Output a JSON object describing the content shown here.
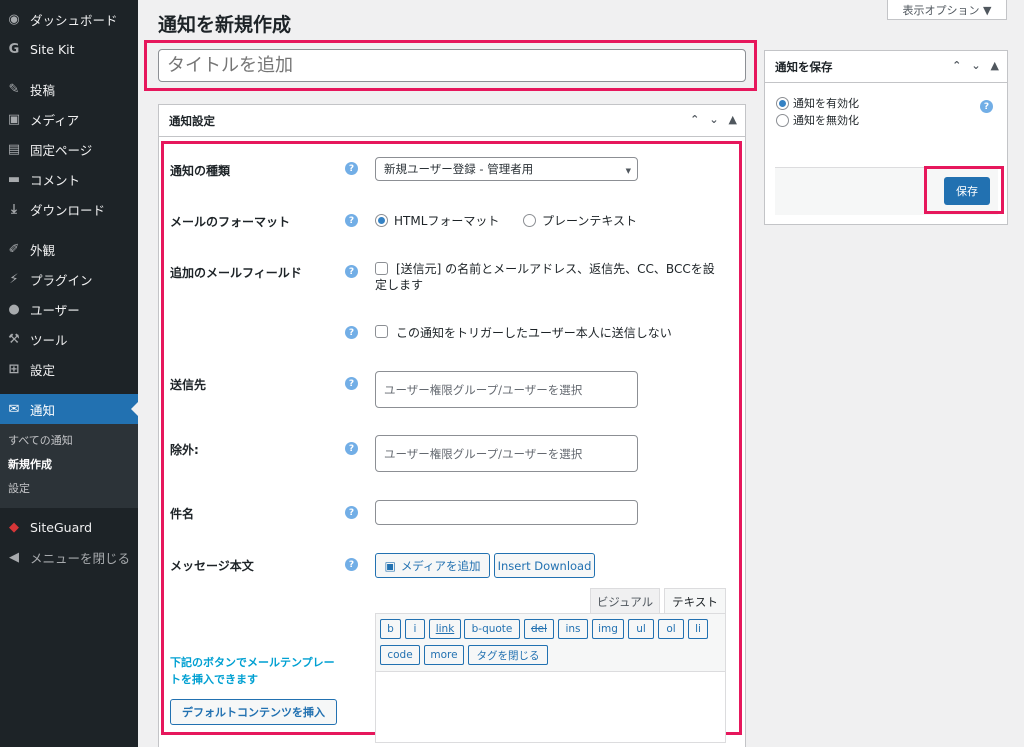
{
  "sidebar": {
    "items": [
      {
        "icon": "dashboard-icon",
        "glyph": "◉",
        "label": "ダッシュボード"
      },
      {
        "icon": "google-g-icon",
        "glyph": "G",
        "label": "Site Kit"
      },
      {
        "icon": "pin-icon",
        "glyph": "✎",
        "label": "投稿"
      },
      {
        "icon": "media-icon",
        "glyph": "▣",
        "label": "メディア"
      },
      {
        "icon": "page-icon",
        "glyph": "▤",
        "label": "固定ページ"
      },
      {
        "icon": "comment-icon",
        "glyph": "▬",
        "label": "コメント"
      },
      {
        "icon": "download-icon",
        "glyph": "⤓",
        "label": "ダウンロード"
      },
      {
        "icon": "appearance-icon",
        "glyph": "✐",
        "label": "外観"
      },
      {
        "icon": "plugin-icon",
        "glyph": "⚡",
        "label": "プラグイン"
      },
      {
        "icon": "user-icon",
        "glyph": "●",
        "label": "ユーザー"
      },
      {
        "icon": "tools-icon",
        "glyph": "⚒",
        "label": "ツール"
      },
      {
        "icon": "settings-icon",
        "glyph": "⊞",
        "label": "設定"
      },
      {
        "icon": "mail-icon",
        "glyph": "✉",
        "label": "通知"
      },
      {
        "icon": "shield-icon",
        "glyph": "◆",
        "label": "SiteGuard"
      },
      {
        "icon": "collapse-icon",
        "glyph": "◀",
        "label": "メニューを閉じる"
      }
    ],
    "submenu": [
      "すべての通知",
      "新規作成",
      "設定"
    ]
  },
  "header": {
    "title": "通知を新規作成",
    "screen_options": "表示オプション ▼"
  },
  "title_input": {
    "placeholder": "タイトルを追加"
  },
  "settings_box": {
    "title": "通知設定",
    "rows": {
      "type_label": "通知の種類",
      "type_value": "新規ユーザー登録 - 管理者用",
      "format_label": "メールのフォーマット",
      "format_html": "HTMLフォーマット",
      "format_plain": "プレーンテキスト",
      "extra_label": "追加のメールフィールド",
      "extra_text_1": "[送信元] の名前とメールアドレス、返信先、CC、BCCを設",
      "extra_text_2": "定します",
      "no_trigger_text": "この通知をトリガーしたユーザー本人に送信しない",
      "to_label": "送信先",
      "to_placeholder": "ユーザー権限グループ/ユーザーを選択",
      "exclude_label": "除外:",
      "exclude_placeholder": "ユーザー権限グループ/ユーザーを選択",
      "subject_label": "件名",
      "body_label": "メッセージ本文",
      "add_media": "メディアを追加",
      "insert_download": "Insert Download",
      "tab_visual": "ビジュアル",
      "tab_text": "テキスト",
      "template_hint_1": "下記のボタンでメールテンプレー",
      "template_hint_2": "トを挿入できます",
      "default_content_btn": "デフォルトコンテンツを挿入"
    },
    "quicktags_row1": [
      "b",
      "i",
      "link",
      "b-quote",
      "del",
      "ins",
      "img",
      "ul",
      "ol",
      "li"
    ],
    "quicktags_row2": [
      "code",
      "more",
      "タグを閉じる"
    ]
  },
  "save_box": {
    "title": "通知を保存",
    "enable": "通知を有効化",
    "disable": "通知を無効化",
    "save": "保存"
  },
  "colors": {
    "accent": "#2271b1",
    "highlight": "#e6175c",
    "help": "#72aee6"
  }
}
